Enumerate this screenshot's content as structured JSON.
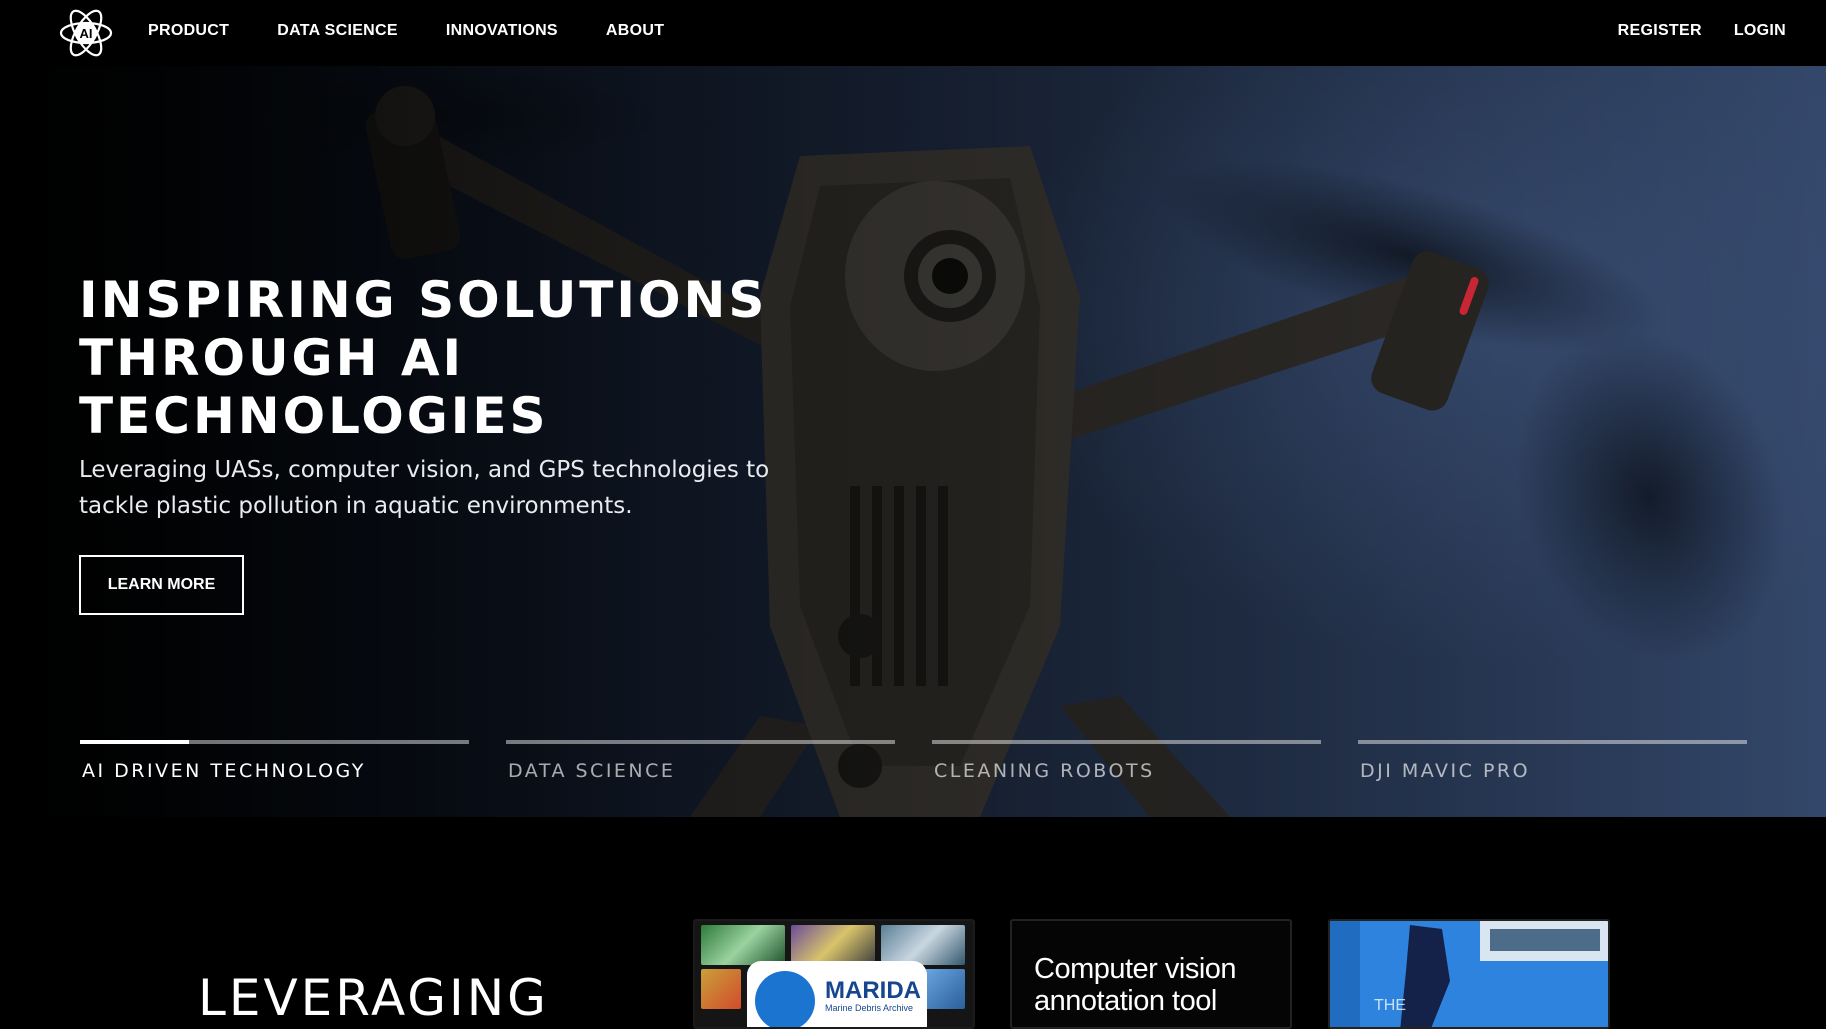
{
  "nav": {
    "logo_icon": "atom-ai-logo-icon",
    "logo_text": "AI",
    "links": [
      "PRODUCT",
      "DATA SCIENCE",
      "INNOVATIONS",
      "ABOUT"
    ],
    "register": "REGISTER",
    "login": "LOGIN"
  },
  "hero": {
    "title_lines": [
      "INSPIRING SOLUTIONS",
      "THROUGH AI",
      "TECHNOLOGIES"
    ],
    "subtitle_lines": [
      "Leveraging UASs, computer vision, and GPS technologies to",
      "tackle plastic pollution in aquatic environments."
    ],
    "button": "LEARN MORE",
    "background": "drone-photo",
    "tabs": [
      {
        "label": "AI DRIVEN TECHNOLOGY",
        "active": true,
        "progress": 0.28
      },
      {
        "label": "DATA SCIENCE",
        "active": false,
        "progress": 0
      },
      {
        "label": "CLEANING ROBOTS",
        "active": false,
        "progress": 0
      },
      {
        "label": "DJI MAVIC PRO",
        "active": false,
        "progress": 0
      }
    ]
  },
  "section": {
    "title": "LEVERAGING",
    "cards": [
      {
        "name": "MARIDA",
        "subtitle": "Marine Debris Archive",
        "image": "plastic-debris-collage"
      },
      {
        "title": "Computer vision annotation tool"
      },
      {
        "image": "ship-photo",
        "text": "THE"
      }
    ]
  },
  "colors": {
    "accent": "#ffffff",
    "background": "#000000",
    "hero_blue": "#33476a",
    "marida_blue": "#17468f"
  }
}
